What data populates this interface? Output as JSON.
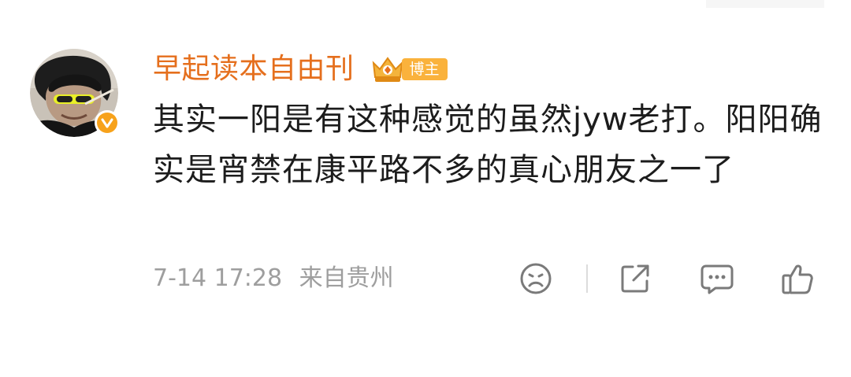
{
  "comment": {
    "username": "早起读本自由刊",
    "author_badge_label": "博主",
    "text": "其实一阳是有这种感觉的虽然jyw老打。阳阳确实是宵禁在康平路不多的真心朋友之一了",
    "time": "7-14 17:28",
    "location": "来自贵州",
    "verified": true
  },
  "icons": {
    "avatar": "user-avatar",
    "verified": "verified-check-icon",
    "author_badge": "crown-badge-icon",
    "reaction": "frown-face-icon",
    "share": "share-icon",
    "reply": "comment-bubble-icon",
    "like": "thumbs-up-icon"
  },
  "colors": {
    "username": "#e56f1d",
    "author_badge": "#fab23c",
    "verified_badge": "#f7a21b",
    "text": "#1c1c1c",
    "meta": "#9e9e9e",
    "icon": "#7a7a7a"
  }
}
